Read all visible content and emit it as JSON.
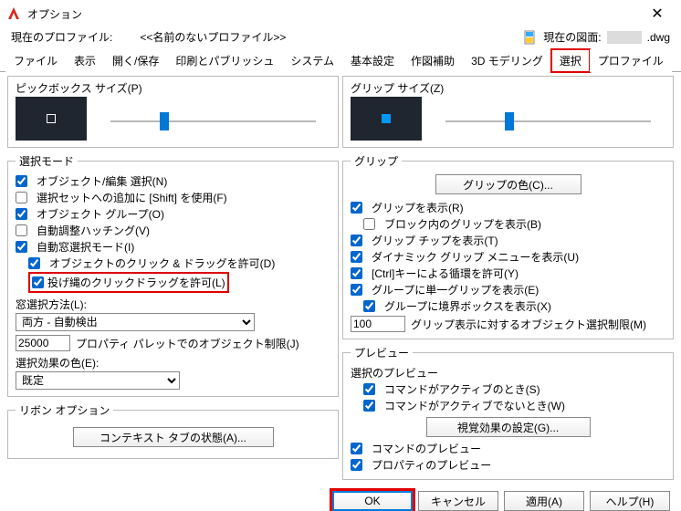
{
  "window": {
    "title": "オプション",
    "close": "✕"
  },
  "profile": {
    "label": "現在のプロファイル:",
    "name": "<<名前のないプロファイル>>",
    "drawing_label": "現在の図面:",
    "drawing_ext": ".dwg"
  },
  "tabs": [
    "ファイル",
    "表示",
    "開く/保存",
    "印刷とパブリッシュ",
    "システム",
    "基本設定",
    "作図補助",
    "3D モデリング",
    "選択",
    "プロファイル"
  ],
  "left": {
    "pickbox_size": "ピックボックス サイズ(P)",
    "selection_mode": {
      "legend": "選択モード",
      "items": {
        "a": "オブジェクト/編集 選択(N)",
        "b": "選択セットへの追加に [Shift] を使用(F)",
        "c": "オブジェクト グループ(O)",
        "d": "自動調整ハッチング(V)",
        "e": "自動窓選択モード(I)",
        "f": "オブジェクトのクリック & ドラッグを許可(D)",
        "g": "投げ縄のクリックドラッグを許可(L)",
        "h_label": "窓選択方法(L):",
        "h_value": "両方 - 自動検出",
        "i_input": "25000",
        "i_label": "プロパティ パレットでのオブジェクト制限(J)",
        "j_label": "選択効果の色(E):",
        "j_value": "既定"
      }
    },
    "ribbon": {
      "legend": "リボン オプション",
      "button": "コンテキスト タブの状態(A)..."
    }
  },
  "right": {
    "grip_size": "グリップ サイズ(Z)",
    "grips": {
      "legend": "グリップ",
      "color_btn": "グリップの色(C)...",
      "items": {
        "a": "グリップを表示(R)",
        "b": "ブロック内のグリップを表示(B)",
        "c": "グリップ チップを表示(T)",
        "d": "ダイナミック グリップ メニューを表示(U)",
        "e": "[Ctrl]キーによる循環を許可(Y)",
        "f": "グループに単一グリップを表示(E)",
        "g": "グループに境界ボックスを表示(X)",
        "h_input": "100",
        "h_label": "グリップ表示に対するオブジェクト選択制限(M)"
      }
    },
    "preview": {
      "legend": "プレビュー",
      "sel_preview": "選択のプレビュー",
      "a": "コマンドがアクティブのとき(S)",
      "b": "コマンドがアクティブでないとき(W)",
      "btn": "視覚効果の設定(G)...",
      "c": "コマンドのプレビュー",
      "d": "プロパティのプレビュー"
    }
  },
  "buttons": {
    "ok": "OK",
    "cancel": "キャンセル",
    "apply": "適用(A)",
    "help": "ヘルプ(H)"
  }
}
